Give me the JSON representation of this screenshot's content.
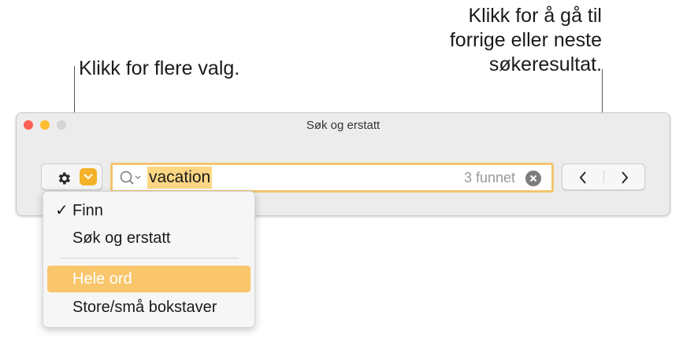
{
  "callouts": {
    "left": "Klikk for flere valg.",
    "right_lines": [
      "Klikk for å gå til",
      "forrige eller neste",
      "søkeresultat."
    ]
  },
  "window": {
    "title": "Søk og erstatt",
    "traffic_colors": [
      "#fe5f57",
      "#febc2e",
      "#d4d4d4"
    ]
  },
  "toolbar": {
    "options_icon": "gear-icon",
    "dropdown_icon": "chevron-down-icon",
    "dropdown_color": "#f3b22a",
    "search": {
      "icon": "search-icon",
      "value": "vacation",
      "result_count": "3 funnet",
      "clear_icon": "clear-icon",
      "highlight_color": "#fcd783",
      "focus_ring_color": "#f3c56e"
    },
    "nav": {
      "previous_icon": "chevron-left-icon",
      "next_icon": "chevron-right-icon"
    }
  },
  "menu": {
    "items": [
      {
        "label": "Finn",
        "checked": true,
        "selected": false
      },
      {
        "label": "Søk og erstatt",
        "checked": false,
        "selected": false
      },
      {
        "label": "Hele ord",
        "checked": false,
        "selected": true
      },
      {
        "label": "Store/små bokstaver",
        "checked": false,
        "selected": false
      }
    ],
    "check_mark": "✓",
    "selection_color": "#f9c66c"
  }
}
